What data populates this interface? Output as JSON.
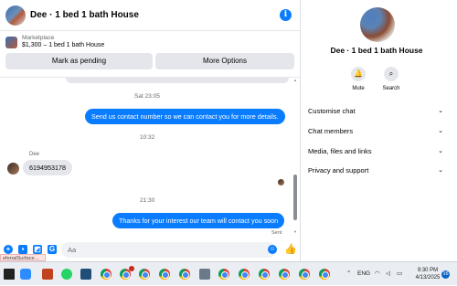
{
  "header": {
    "title": "Dee · 1 bed 1 bath House",
    "info_icon": "info-icon"
  },
  "listing": {
    "category": "Marketplace",
    "price_title": "$1,300 – 1 bed 1 bath House",
    "pending_button": "Mark as pending",
    "options_button": "More Options"
  },
  "messages": {
    "timestamp_1": "Sat 23:05",
    "msg_1": "Send us contact number so we can contact you for more details.",
    "timestamp_2": "10:32",
    "sender": "Dee",
    "msg_2": "6194953178",
    "timestamp_3": "21:30",
    "msg_3": "Thanks for your interest our team will contact you soon",
    "status": "Sent"
  },
  "composer": {
    "placeholder": "Aa"
  },
  "tooltip": "eferralSurface…",
  "side": {
    "name": "Dee · 1 bed 1 bath House",
    "mute_label": "Mute",
    "search_label": "Search",
    "rows": [
      {
        "label": "Customise chat"
      },
      {
        "label": "Chat members"
      },
      {
        "label": "Media, files and links"
      },
      {
        "label": "Privacy and support"
      }
    ]
  },
  "taskbar": {
    "language": "ENG",
    "time": "9:30 PM",
    "date": "4/13/2025",
    "notifications": "16"
  },
  "colors": {
    "accent": "#0a7cff",
    "bubble_in": "#e4e6eb",
    "button_grey": "#e4e6eb"
  }
}
